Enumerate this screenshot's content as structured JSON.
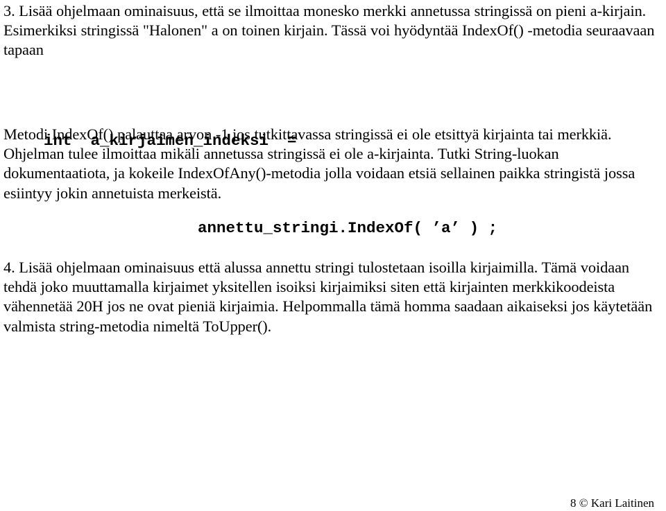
{
  "document": {
    "language": "fi",
    "page_background": "#ffffff",
    "text_color": "#000000"
  },
  "body": {
    "exercise_3": {
      "text": "3.  Lisää ohjelmaan ominaisuus, että se ilmoittaa monesko merkki annetussa stringissä on pieni a-kirjain. Esimerkiksi stringissä \"Halonen\" a on toinen kirjain. Tässä voi hyödyntää IndexOf() -metodia seuraavaan tapaan"
    },
    "code_block": {
      "line_1": "int  a_kirjaimen_indeksi  =",
      "line_2": "annettu_stringi.IndexOf( ’a’ ) ;"
    },
    "explanation": {
      "text": "Metodi IndexOf() palauttaa arvon -1 jos tutkittavassa stringissä ei ole etsittyä kirjainta tai merkkiä. Ohjelman tulee ilmoittaa mikäli annetussa stringissä ei ole a-kirjainta. Tutki String-luokan dokumentaatiota, ja kokeile IndexOfAny()-metodia jolla voidaan etsiä sellainen paikka stringistä jossa esiintyy jokin annetuista merkeistä."
    },
    "exercise_4": {
      "text": "4.  Lisää ohjelmaan ominaisuus että alussa annettu stringi tulostetaan isoilla kirjaimilla. Tämä voidaan tehdä joko muuttamalla kirjaimet yksitellen isoiksi kirjaimiksi siten että kirjainten merkkikoodeista vähennetää 20H jos ne ovat pieniä kirjaimia. Helpommalla tämä homma saadaan aikaiseksi jos käytetään valmista string-metodia nimeltä ToUpper()."
    }
  },
  "footer": {
    "text": "8 © Kari Laitinen",
    "page_number": "8",
    "copyright_symbol": "©",
    "author": "Kari Laitinen"
  }
}
